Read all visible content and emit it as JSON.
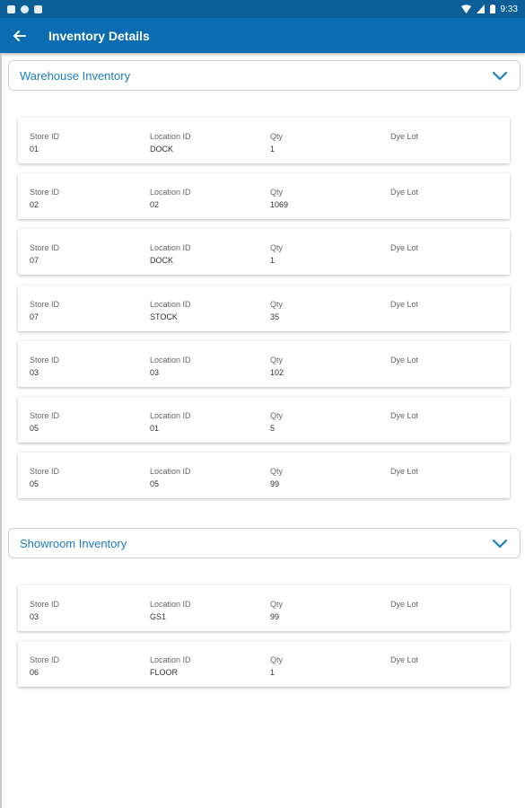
{
  "status_bar": {
    "time": "9:33"
  },
  "app_bar": {
    "title": "Inventory Details"
  },
  "sections": [
    {
      "title": "Warehouse Inventory",
      "columns": [
        "Store ID",
        "Location ID",
        "Qty",
        "Dye Lot"
      ],
      "rows": [
        {
          "store_id": "01",
          "location_id": "DOCK",
          "qty": "1",
          "dye_lot": ""
        },
        {
          "store_id": "02",
          "location_id": "02",
          "qty": "1069",
          "dye_lot": ""
        },
        {
          "store_id": "07",
          "location_id": "DOCK",
          "qty": "1",
          "dye_lot": ""
        },
        {
          "store_id": "07",
          "location_id": "STOCK",
          "qty": "35",
          "dye_lot": ""
        },
        {
          "store_id": "03",
          "location_id": "03",
          "qty": "102",
          "dye_lot": ""
        },
        {
          "store_id": "05",
          "location_id": "01",
          "qty": "5",
          "dye_lot": ""
        },
        {
          "store_id": "05",
          "location_id": "05",
          "qty": "99",
          "dye_lot": ""
        }
      ]
    },
    {
      "title": "Showroom Inventory",
      "columns": [
        "Store ID",
        "Location ID",
        "Qty",
        "Dye Lot"
      ],
      "rows": [
        {
          "store_id": "03",
          "location_id": "GS1",
          "qty": "99",
          "dye_lot": ""
        },
        {
          "store_id": "06",
          "location_id": "FLOOR",
          "qty": "1",
          "dye_lot": ""
        }
      ]
    }
  ],
  "colors": {
    "status_bar": "#0b5e98",
    "app_bar": "#0a6cb1",
    "accent": "#1a7ec0"
  },
  "icons": [
    "back-arrow-icon",
    "chevron-down-icon",
    "wifi-icon",
    "signal-icon",
    "battery-icon"
  ]
}
